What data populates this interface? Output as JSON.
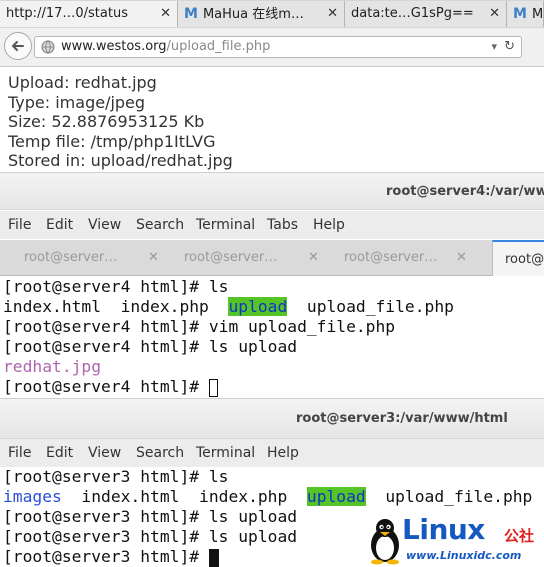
{
  "browser": {
    "tabs": [
      {
        "label": "http://17…0/status"
      },
      {
        "label": "MaHua 在线m…",
        "icon": "mahua-m-icon"
      },
      {
        "label": "data:te…G1sPg=="
      },
      {
        "label": "M"
      }
    ],
    "url": {
      "host": "www.westos.org",
      "path": "/upload_file.php"
    },
    "page_lines": [
      "Upload: redhat.jpg",
      "Type: image/jpeg",
      "Size: 52.8876953125 Kb",
      "Temp file: /tmp/php1ItLVG",
      "Stored in: upload/redhat.jpg"
    ]
  },
  "terminal_server4": {
    "title": "root@server4:/var/www",
    "menu": [
      "File",
      "Edit",
      "View",
      "Search",
      "Terminal",
      "Tabs",
      "Help"
    ],
    "tabs": [
      "root@server…",
      "root@server…",
      "root@server…",
      "root@"
    ],
    "lines": {
      "l1": "[root@server4 html]# ls",
      "l2a": "index.html  index.php  ",
      "l2b": "upload",
      "l2c": "  upload_file.php",
      "l3": "[root@server4 html]# vim upload_file.php",
      "l4": "[root@server4 html]# ls upload",
      "l5": "redhat.jpg",
      "l6": "[root@server4 html]# "
    }
  },
  "terminal_server3": {
    "title": "root@server3:/var/www/html",
    "menu": [
      "File",
      "Edit",
      "View",
      "Search",
      "Terminal",
      "Help"
    ],
    "lines": {
      "l1": "[root@server3 html]# ls",
      "l2a": "images",
      "l2b": "  index.html  index.php  ",
      "l2c": "upload",
      "l2d": "  upload_file.php",
      "l3": "[root@server3 html]# ls upload",
      "l4": "[root@server3 html]# ls upload",
      "l5": "[root@server3 html]# "
    }
  },
  "watermark": {
    "brand": "Linux",
    "cn": "公社",
    "url": "www.Linuxidc.com"
  },
  "colors": {
    "directory": "#2a4fd6",
    "highlight_bg": "#54c427",
    "image_file": "#b064b0",
    "active_tab": "#3584e4"
  }
}
